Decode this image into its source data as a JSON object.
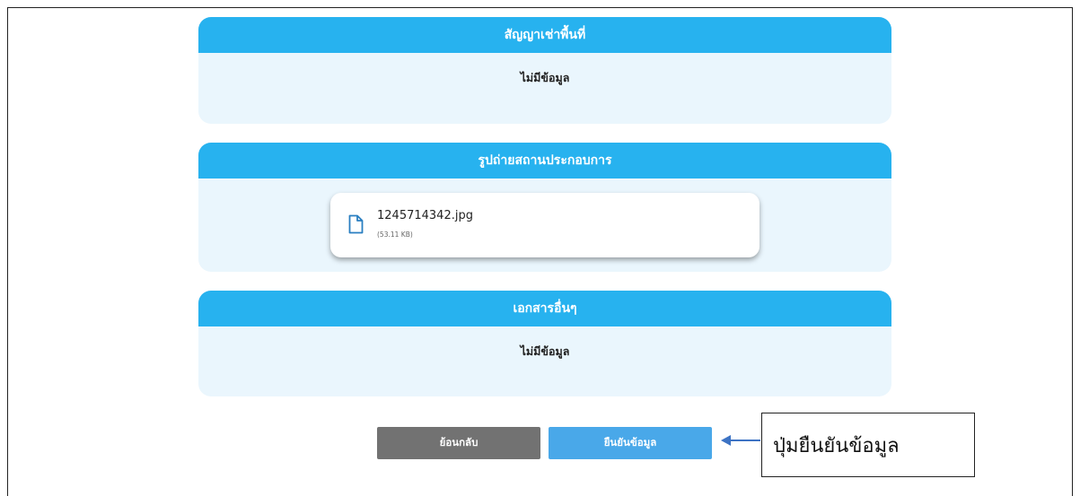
{
  "sections": [
    {
      "title": "สัญญาเช่าพื้นที่",
      "empty_text": "ไม่มีข้อมูล"
    },
    {
      "title": "รูปถ่ายสถานประกอบการ",
      "file": {
        "name": "1245714342.jpg",
        "size": "(53.11 KB)",
        "icon": "file-icon"
      }
    },
    {
      "title": "เอกสารอื่นๆ",
      "empty_text": "ไม่มีข้อมูล"
    }
  ],
  "buttons": {
    "back_label": "ย้อนกลับ",
    "confirm_label": "ยืนยันข้อมูล"
  },
  "annotation": {
    "callout_text": "ปุ่มยืนยันข้อมูล",
    "arrow_icon": "left-arrow-icon"
  },
  "colors": {
    "header": "#27b2ef",
    "card_bg": "#eaf6fd",
    "back_button": "#727272",
    "confirm_button": "#49a8e9",
    "arrow": "#3d73c4"
  }
}
